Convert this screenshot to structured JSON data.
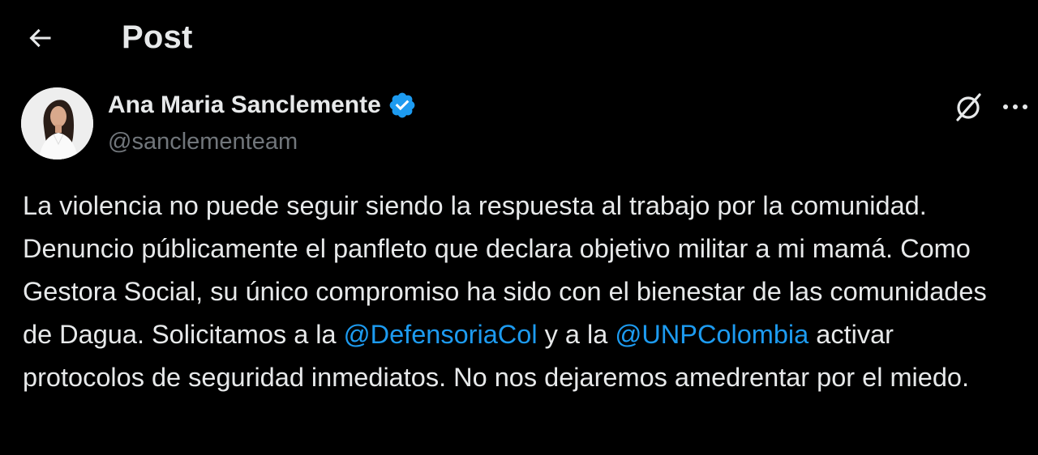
{
  "header": {
    "back_icon": "arrow-left-icon",
    "title": "Post"
  },
  "author": {
    "name": "Ana Maria Sanclemente",
    "handle": "@sanclementeam",
    "verified_icon": "verified-badge-icon",
    "verified_color": "#1d9bf0"
  },
  "actions": {
    "grok_icon": "grok-icon",
    "more_icon": "more-horizontal-icon"
  },
  "post": {
    "text_part1": "La violencia no puede seguir siendo la respuesta al trabajo por la comunidad. Denuncio públicamente el panfleto que declara objetivo militar a mi mamá. Como Gestora Social, su único compromiso ha sido con el bienestar de las comunidades de Dagua. Solicitamos a la ",
    "mention1": "@DefensoriaCol",
    "text_part2": " y a la ",
    "mention2": "@UNPColombia",
    "text_part3": " activar protocolos de seguridad inmediatos. No nos dejaremos amedrentar por el miedo."
  },
  "colors": {
    "background": "#000000",
    "text": "#e7e9ea",
    "secondary_text": "#71767b",
    "link": "#1d9bf0"
  }
}
